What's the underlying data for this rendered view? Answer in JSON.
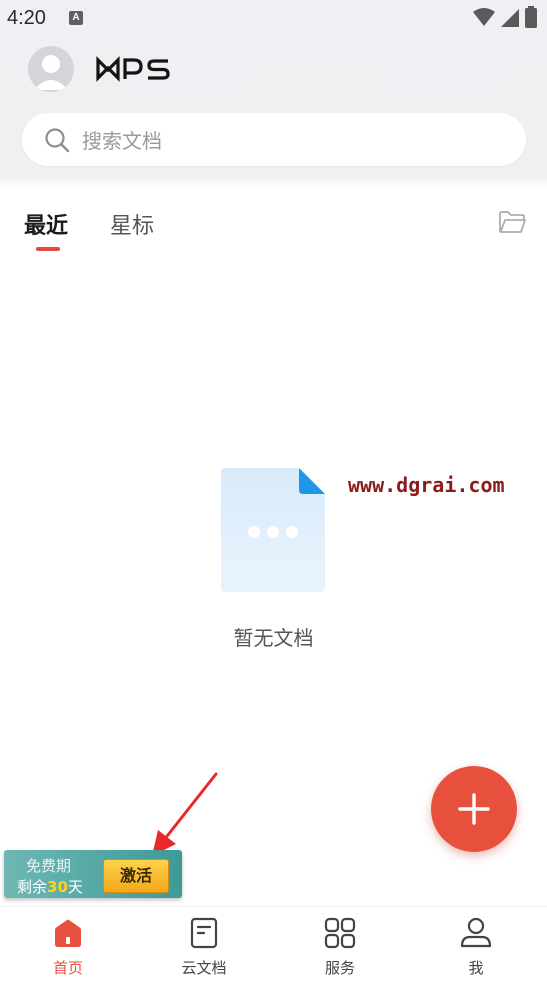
{
  "status_bar": {
    "time": "4:20",
    "notification_letter": "A"
  },
  "header": {
    "brand": "WPS",
    "search_placeholder": "搜索文档"
  },
  "tabs": [
    {
      "label": "最近",
      "active": true
    },
    {
      "label": "星标",
      "active": false
    }
  ],
  "empty_state": {
    "text": "暂无文档"
  },
  "watermark": "www.dgrai.com",
  "trial_banner": {
    "line1": "免费期",
    "line2_prefix": "剩余",
    "days": "30",
    "line2_suffix": "天",
    "activate_label": "激活"
  },
  "bottom_nav": [
    {
      "label": "首页",
      "icon": "home-icon",
      "active": true
    },
    {
      "label": "云文档",
      "icon": "cloud-doc-icon",
      "active": false
    },
    {
      "label": "服务",
      "icon": "services-grid-icon",
      "active": false
    },
    {
      "label": "我",
      "icon": "profile-icon",
      "active": false
    }
  ],
  "colors": {
    "accent": "#e8503e",
    "tab_indicator": "#e24b3f",
    "watermark": "#8b1a1a",
    "trial_bg": "#3e9a98",
    "activate_bg": "#f4a81c"
  }
}
